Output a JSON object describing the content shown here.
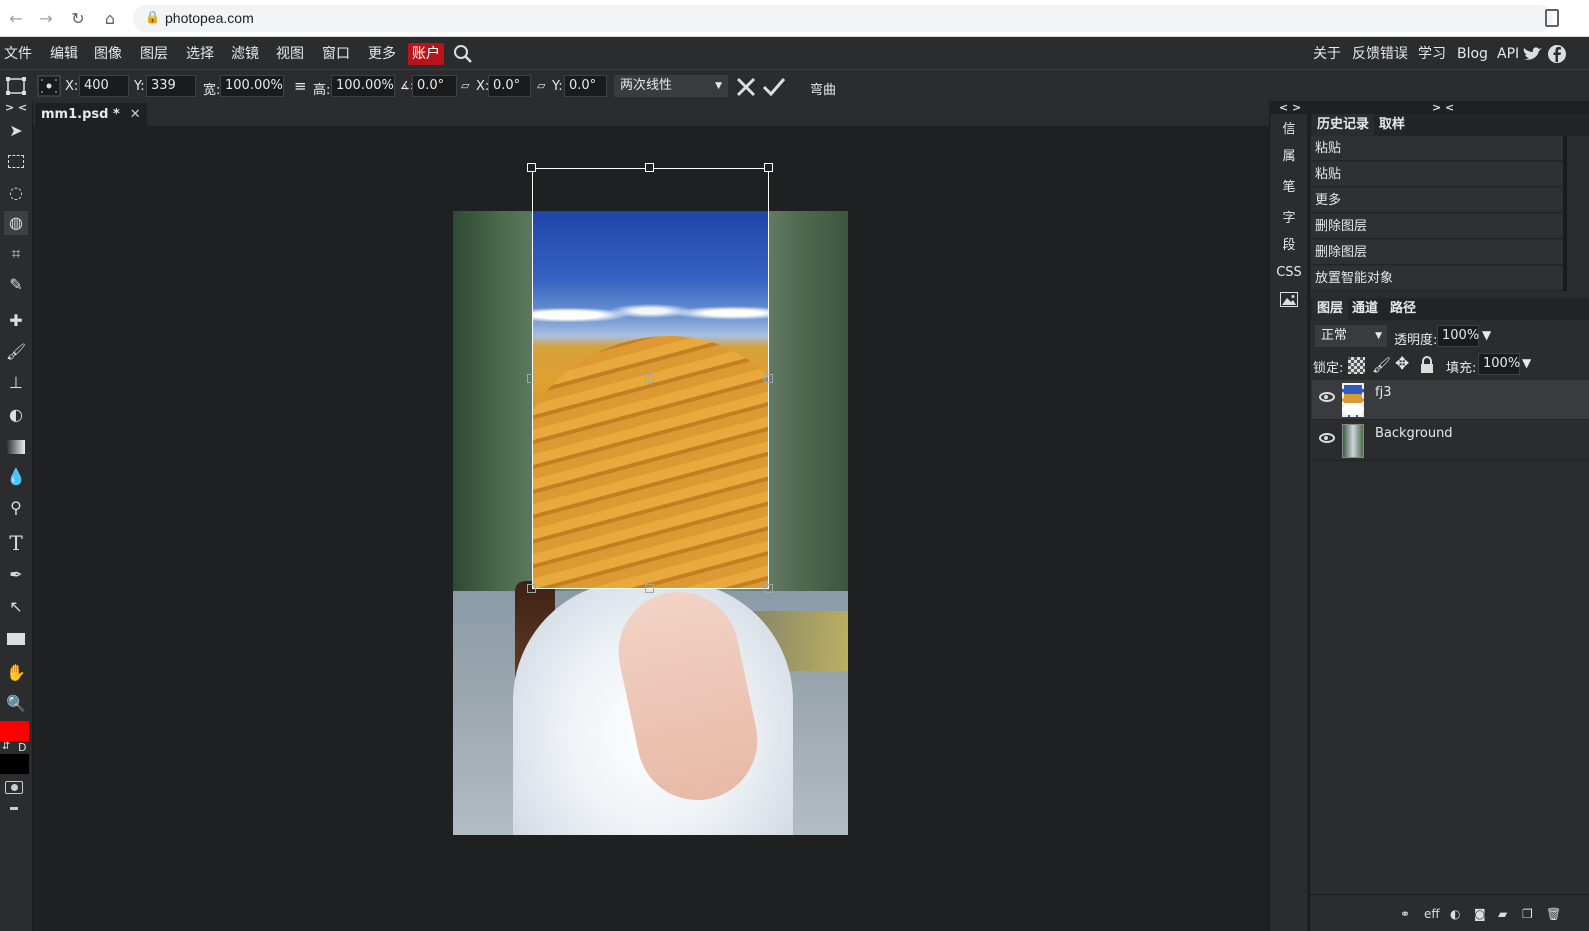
{
  "browser": {
    "url": "photopea.com"
  },
  "menu": {
    "items": [
      "文件",
      "编辑",
      "图像",
      "图层",
      "选择",
      "滤镜",
      "视图",
      "窗口",
      "更多"
    ],
    "account": "账户",
    "right": [
      "关于",
      "反馈错误",
      "学习",
      "Blog",
      "API"
    ]
  },
  "options": {
    "x_label": "X:",
    "x_value": "400 px",
    "y_label": "Y:",
    "y_value": "339 px",
    "w_label": "宽:",
    "w_value": "100.00%",
    "link_glyph": "≡",
    "h_label": "高:",
    "h_value": "100.00%",
    "angle_label": "∡:",
    "angle_value": "0.0°",
    "skew_x_label": "X:",
    "skew_x_value": "0.0°",
    "skew_y_label": "Y:",
    "skew_y_value": "0.0°",
    "interpolation": "两次线性",
    "warp": "弯曲"
  },
  "document": {
    "tab": "mm1.psd *",
    "close": "✕"
  },
  "dock": {
    "left_toggle": "> <",
    "mini_toggle": "< >",
    "right_toggle": "> <",
    "mini_items": [
      "信",
      "属",
      "笔",
      "字",
      "段",
      "CSS"
    ]
  },
  "history": {
    "tabs": [
      "历史记录",
      "取样"
    ],
    "items": [
      "粘贴",
      "粘贴",
      "更多",
      "删除图层",
      "删除图层",
      "放置智能对象"
    ]
  },
  "layers": {
    "tabs": [
      "图层",
      "通道",
      "路径"
    ],
    "blend_mode": "正常",
    "opacity_label": "透明度:",
    "opacity": "100%",
    "lock_label": "锁定:",
    "fill_label": "填充:",
    "fill": "100%",
    "rows": [
      {
        "name": "fj3",
        "selected": true
      },
      {
        "name": "Background",
        "selected": false
      }
    ],
    "bottom_eff": "eff"
  },
  "colors": {
    "foreground": "#ff0000",
    "background": "#000000",
    "accent": "#b8141b"
  }
}
